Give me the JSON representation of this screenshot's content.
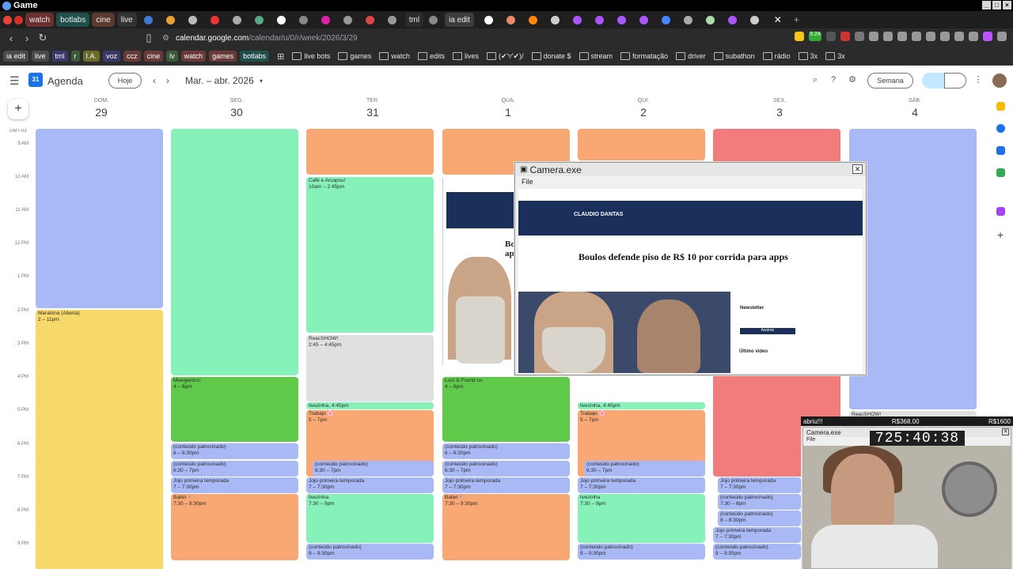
{
  "window": {
    "title": "Game"
  },
  "tabs": [
    {
      "label": "watch",
      "style": "w"
    },
    {
      "label": "botlabs",
      "style": "b"
    },
    {
      "label": "cine",
      "style": "c"
    },
    {
      "label": "live",
      "style": "g"
    },
    {
      "label": "tml",
      "style": "p"
    },
    {
      "label": "ia edit",
      "style": "a"
    }
  ],
  "address": {
    "domain": "calendar.google.com",
    "path": "/calendar/u/0/r/week/2026/3/29"
  },
  "extension_badge": "5.24",
  "bookmarks_pills": [
    {
      "label": "ia edit",
      "color": "#4a4a4a"
    },
    {
      "label": "live",
      "color": "#4a4a4a"
    },
    {
      "label": "tml",
      "color": "#3a3a6a"
    },
    {
      "label": "r",
      "color": "#3a5a3a"
    },
    {
      "label": "I.A.",
      "color": "#6a6a2a"
    },
    {
      "label": "voz",
      "color": "#3a3a6a"
    },
    {
      "label": "ccz",
      "color": "#6a3a3a"
    },
    {
      "label": "cine",
      "color": "#6a3a3a"
    },
    {
      "label": "lv",
      "color": "#3a5a3a"
    },
    {
      "label": "watch",
      "color": "#6a3a3a"
    },
    {
      "label": "games",
      "color": "#6a3a3a"
    },
    {
      "label": "botlabs",
      "color": "#1f4e4b"
    }
  ],
  "bookmarks_folders": [
    "live bots",
    "games",
    "watch",
    "edits",
    "lives",
    "(✔'▿'✔)/",
    "donate $",
    "stream",
    "formatação",
    "driver",
    "subathon",
    "rádio",
    "3x",
    "3x"
  ],
  "calendar": {
    "app_name": "Agenda",
    "today_btn": "Hoje",
    "period": "Mar. – abr. 2026",
    "view": "Semana",
    "timezone": "GMT-03",
    "hours": [
      "9 AM",
      "10 AM",
      "11 AM",
      "12 PM",
      "1 PM",
      "2 PM",
      "3 PM",
      "4 PM",
      "5 PM",
      "6 PM",
      "7 PM",
      "8 PM",
      "9 PM"
    ],
    "days": [
      {
        "name": "DOM.",
        "num": "29"
      },
      {
        "name": "SEG.",
        "num": "30"
      },
      {
        "name": "TER.",
        "num": "31"
      },
      {
        "name": "QUA.",
        "num": "1"
      },
      {
        "name": "QUI.",
        "num": "2"
      },
      {
        "name": "SEX.",
        "num": "3"
      },
      {
        "name": "SÁB.",
        "num": "4"
      }
    ],
    "events": [
      {
        "title": "Maratona (Aberta)",
        "time": "2 – 11pm"
      },
      {
        "title": "Café e Arcapsu!",
        "time": "10am – 2:45pm"
      },
      {
        "title": "ReacSHOW!",
        "time": "2:45 – 4:45pm"
      },
      {
        "title": "Mewgenics!",
        "time": "4 – 6pm"
      },
      {
        "title": "Lost & Found co.",
        "time": "4 – 6pm"
      },
      {
        "title": "livezinha,",
        "time": "4:45pm"
      },
      {
        "title": "Trabajo 🌸",
        "time": "5 – 7pm"
      },
      {
        "title": "(conteúdo patrocinado)",
        "time": "6 – 6:30pm"
      },
      {
        "title": "(conteúdo patrocinado)",
        "time": "6:30 – 7pm"
      },
      {
        "title": "Jojo primeira temporada",
        "time": "7 – 7:30pm"
      },
      {
        "title": "Ballet 🩰",
        "time": "7:30 – 9:30pm"
      },
      {
        "title": "livezinha",
        "time": "7:30 – 9pm"
      },
      {
        "title": "(conteúdo patrocinado)",
        "time": "9 – 9:30pm"
      },
      {
        "title": "(conteúdo patrocinado)",
        "time": "7:30 – 8pm"
      },
      {
        "title": "(conteúdo patrocinado)",
        "time": "8 – 8:30pm"
      },
      {
        "title": "ReacSHOW!",
        "time": ""
      }
    ]
  },
  "camera_window": {
    "title": "Camera.exe",
    "menu": "File",
    "headline": "Boulos defende piso de R$ 10 por corrida para apps",
    "site_logo": "CLAUDIO DANTAS",
    "newsletter": "Newsletter",
    "latest_video": "Último vídeo",
    "subscribe": "Assinar"
  },
  "left_web": {
    "headline": "Bo ap"
  },
  "stream_overlay": {
    "goal_text": "abriu!!!",
    "amount_current": "R$368.00",
    "amount_goal": "R$1600",
    "cam_title": "Camera.exe",
    "cam_menu": "File",
    "timer": "725:40:38"
  },
  "colors": {
    "blue": "#a8b9f5",
    "green": "#86f2b9",
    "dark_green": "#5fc94a",
    "orange": "#f9a873",
    "yellow": "#f6d96a",
    "red": "#f27b7b",
    "gray": "#e0e0e0"
  }
}
